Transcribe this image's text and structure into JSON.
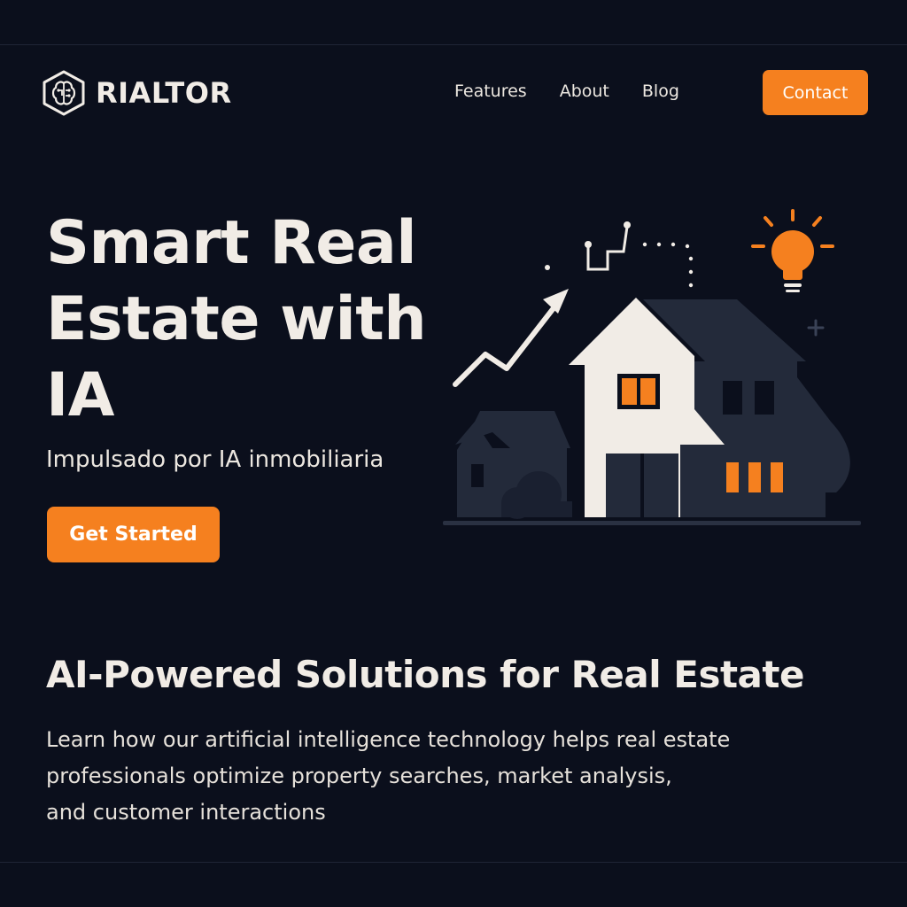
{
  "brand": {
    "name": "RIALTOR",
    "logo_icon": "brain-hexagon-icon"
  },
  "nav": {
    "links": [
      "Features",
      "About",
      "Blog"
    ],
    "contact_label": "Contact"
  },
  "hero": {
    "title": "Smart Real Estate with IA",
    "subtitle": "Impulsado por IA inmobiliaria",
    "cta_label": "Get Started",
    "illustration_icons": [
      "trend-arrow-icon",
      "circuit-icon",
      "lightbulb-icon",
      "plus-icon",
      "house-icon"
    ]
  },
  "section": {
    "title": "AI-Powered Solutions for Real Estate",
    "body_lines": [
      "Learn how our artificial intelligence technology helps real estate",
      "professionals optimize property searches, market analysis,",
      "and customer interactions"
    ]
  },
  "colors": {
    "background": "#0b0f1c",
    "accent": "#f5801f",
    "text": "#f1ece6",
    "house_dark": "#232a3a"
  }
}
